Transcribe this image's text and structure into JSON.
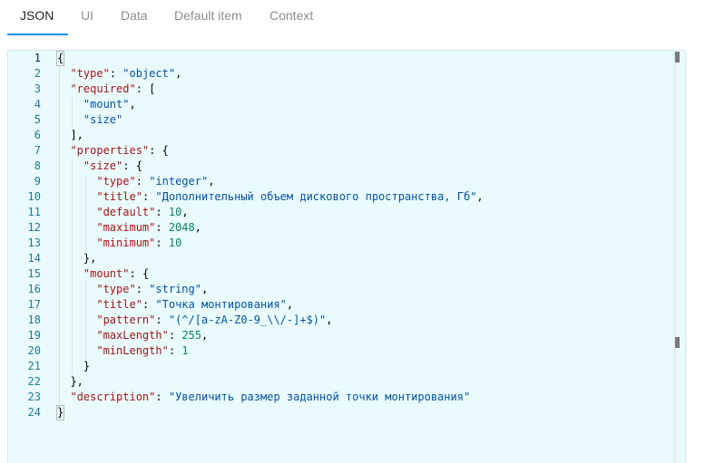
{
  "tabs": [
    {
      "label": "JSON",
      "active": true
    },
    {
      "label": "UI",
      "active": false
    },
    {
      "label": "Data",
      "active": false
    },
    {
      "label": "Default item",
      "active": false
    },
    {
      "label": "Context",
      "active": false
    }
  ],
  "editor": {
    "current_line": 1,
    "lines": [
      {
        "n": "1",
        "text": "{"
      },
      {
        "n": "2",
        "text": "  \"type\": \"object\","
      },
      {
        "n": "3",
        "text": "  \"required\": ["
      },
      {
        "n": "4",
        "text": "    \"mount\","
      },
      {
        "n": "5",
        "text": "    \"size\""
      },
      {
        "n": "6",
        "text": "  ],"
      },
      {
        "n": "7",
        "text": "  \"properties\": {"
      },
      {
        "n": "8",
        "text": "    \"size\": {"
      },
      {
        "n": "9",
        "text": "      \"type\": \"integer\","
      },
      {
        "n": "10",
        "text": "      \"title\": \"Дополнительный объем дискового пространства, Гб\","
      },
      {
        "n": "11",
        "text": "      \"default\": 10,"
      },
      {
        "n": "12",
        "text": "      \"maximum\": 2048,"
      },
      {
        "n": "13",
        "text": "      \"minimum\": 10"
      },
      {
        "n": "14",
        "text": "    },"
      },
      {
        "n": "15",
        "text": "    \"mount\": {"
      },
      {
        "n": "16",
        "text": "      \"type\": \"string\","
      },
      {
        "n": "17",
        "text": "      \"title\": \"Точка монтирования\","
      },
      {
        "n": "18",
        "text": "      \"pattern\": \"(^/[a-zA-Z0-9_\\\\/-]+$)\","
      },
      {
        "n": "19",
        "text": "      \"maxLength\": 255,"
      },
      {
        "n": "20",
        "text": "      \"minLength\": 1"
      },
      {
        "n": "21",
        "text": "    }"
      },
      {
        "n": "22",
        "text": "  },"
      },
      {
        "n": "23",
        "text": "  \"description\": \"Увеличить размер заданной точки монтирования\""
      },
      {
        "n": "24",
        "text": "}"
      }
    ]
  },
  "colors": {
    "tab_accent": "#1890ff",
    "editor_background": "#e9fbfd",
    "json_key": "#a31515",
    "json_string": "#0451a5",
    "json_number": "#098658"
  }
}
